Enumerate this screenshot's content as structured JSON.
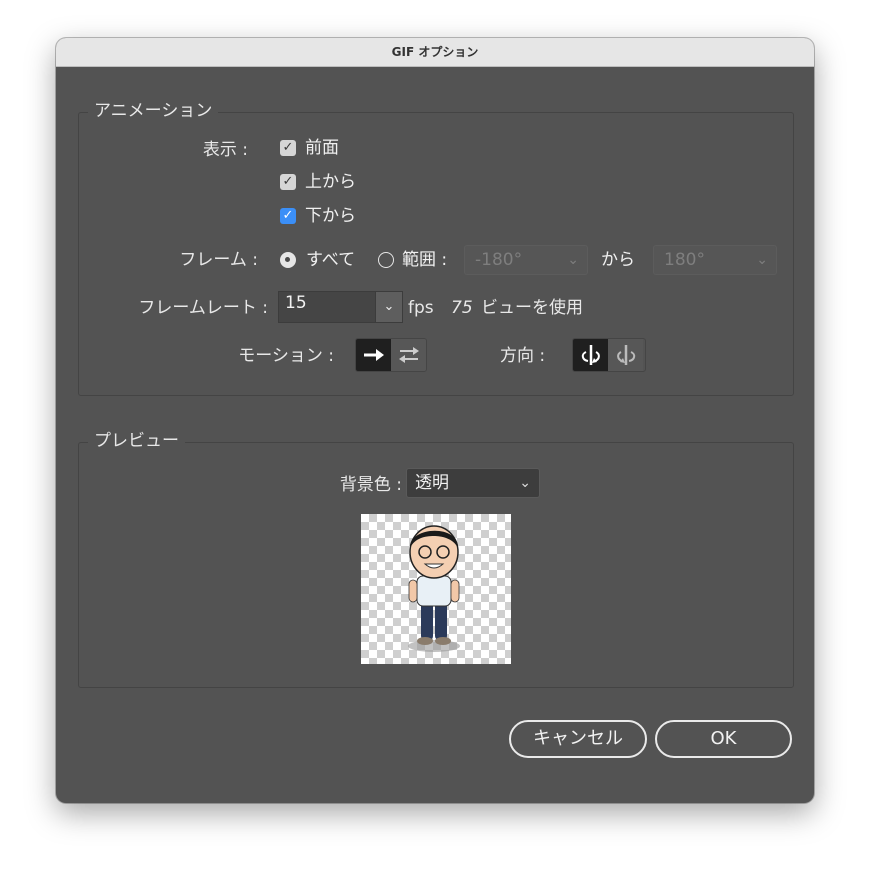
{
  "window": {
    "title": "GIF オプション"
  },
  "animation": {
    "group_title": "アニメーション",
    "display_label": "表示 :",
    "checkboxes": [
      {
        "label": "前面",
        "checked": true,
        "accent": false
      },
      {
        "label": "上から",
        "checked": true,
        "accent": false
      },
      {
        "label": "下から",
        "checked": true,
        "accent": true
      }
    ],
    "frame_label": "フレーム :",
    "radio_all": "すべて",
    "radio_range": "範囲 :",
    "range_from": "-180°",
    "range_to_word": "から",
    "range_to": "180°",
    "framerate_label": "フレームレート :",
    "framerate_value": "15",
    "fps_unit": "fps",
    "views_count": "75",
    "views_text": "ビューを使用",
    "motion_label": "モーション :",
    "direction_label": "方向 :"
  },
  "preview": {
    "group_title": "プレビュー",
    "bg_label": "背景色 :",
    "bg_value": "透明"
  },
  "buttons": {
    "cancel": "キャンセル",
    "ok": "OK"
  },
  "colors": {
    "window_bg": "#535353",
    "accent": "#3b8ff7"
  },
  "icons": [
    "checkmark-icon",
    "chevron-down-icon",
    "arrow-right-icon",
    "swap-arrows-icon",
    "rotate-cw-icon",
    "rotate-ccw-icon"
  ]
}
